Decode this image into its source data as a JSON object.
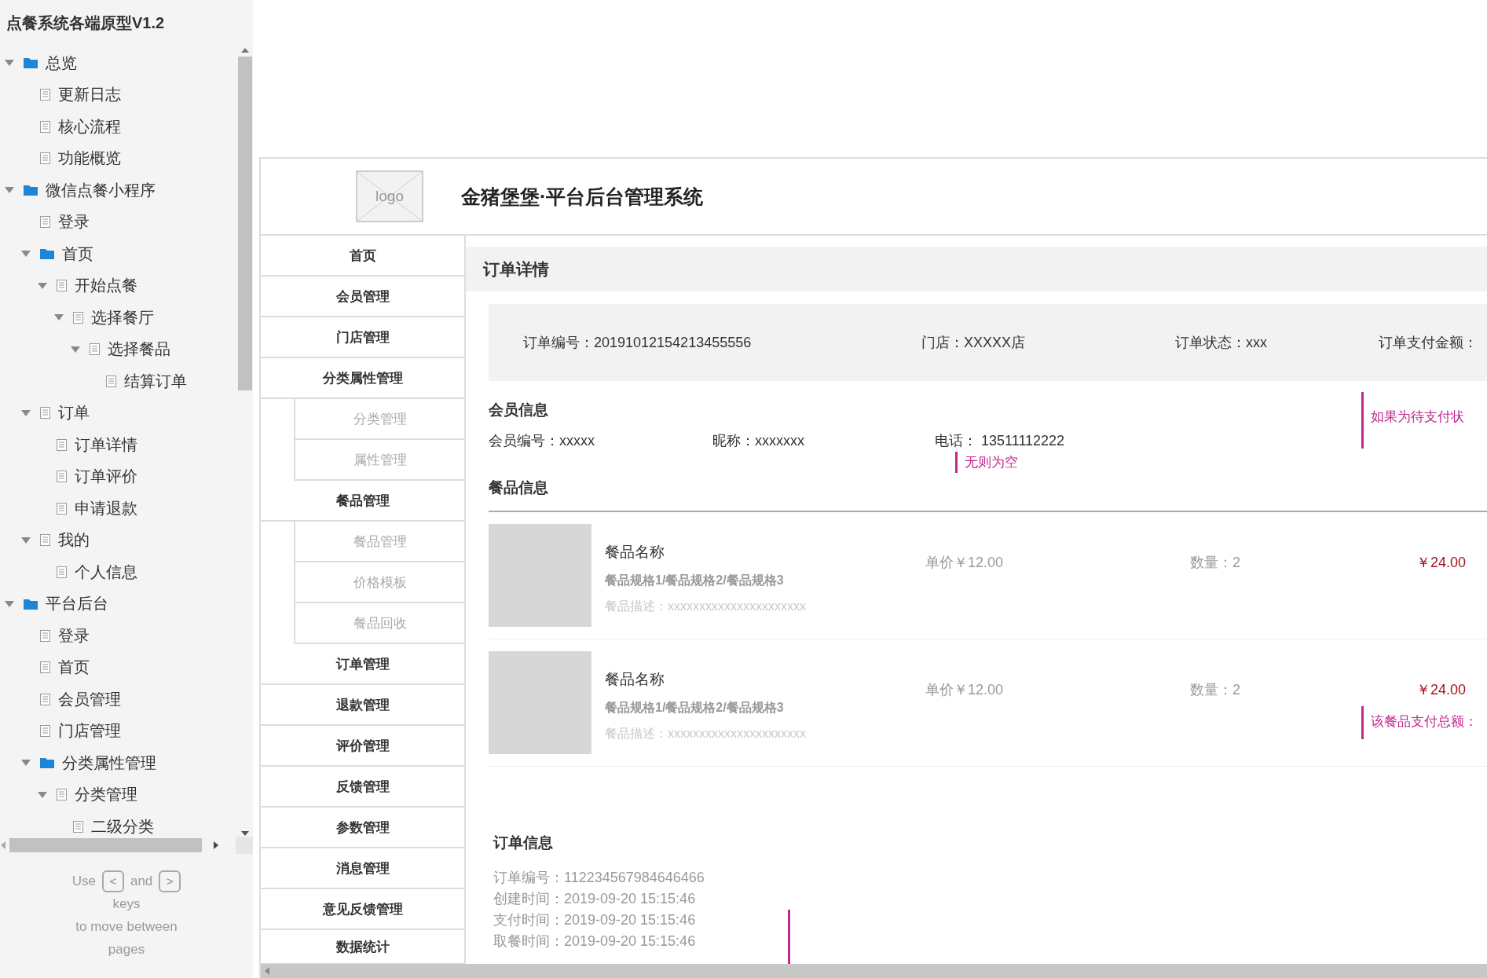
{
  "sidebar": {
    "title": "点餐系统各端原型V1.2",
    "tree": [
      {
        "label": "总览",
        "kind": "folder",
        "expanded": true,
        "children": [
          {
            "label": "更新日志",
            "kind": "page"
          },
          {
            "label": "核心流程",
            "kind": "page"
          },
          {
            "label": "功能概览",
            "kind": "page"
          }
        ]
      },
      {
        "label": "微信点餐小程序",
        "kind": "folder",
        "expanded": true,
        "children": [
          {
            "label": "登录",
            "kind": "page"
          },
          {
            "label": "首页",
            "kind": "folder",
            "expanded": true,
            "children": [
              {
                "label": "开始点餐",
                "kind": "page",
                "expanded": true,
                "children": [
                  {
                    "label": "选择餐厅",
                    "kind": "page",
                    "expanded": true,
                    "children": [
                      {
                        "label": "选择餐品",
                        "kind": "page",
                        "expanded": true,
                        "children": [
                          {
                            "label": "结算订单",
                            "kind": "page"
                          }
                        ]
                      }
                    ]
                  }
                ]
              }
            ]
          },
          {
            "label": "订单",
            "kind": "page",
            "expanded": true,
            "children": [
              {
                "label": "订单详情",
                "kind": "page"
              },
              {
                "label": "订单评价",
                "kind": "page"
              },
              {
                "label": "申请退款",
                "kind": "page"
              }
            ]
          },
          {
            "label": "我的",
            "kind": "page",
            "expanded": true,
            "children": [
              {
                "label": "个人信息",
                "kind": "page"
              }
            ]
          }
        ]
      },
      {
        "label": "平台后台",
        "kind": "folder",
        "expanded": true,
        "children": [
          {
            "label": "登录",
            "kind": "page"
          },
          {
            "label": "首页",
            "kind": "page"
          },
          {
            "label": "会员管理",
            "kind": "page"
          },
          {
            "label": "门店管理",
            "kind": "page"
          },
          {
            "label": "分类属性管理",
            "kind": "folder",
            "expanded": true,
            "children": [
              {
                "label": "分类管理",
                "kind": "page",
                "expanded": true,
                "children": [
                  {
                    "label": "二级分类",
                    "kind": "page"
                  }
                ]
              }
            ]
          }
        ]
      }
    ],
    "footer": {
      "use": "Use",
      "prev_key": "<",
      "and": "and",
      "next_key": ">",
      "keys": "keys",
      "line": "to move between",
      "pages": "pages"
    }
  },
  "header": {
    "logo": "logo",
    "title": "金猪堡堡·平台后台管理系统"
  },
  "nav": [
    {
      "label": "首页",
      "kind": "main"
    },
    {
      "label": "会员管理",
      "kind": "main"
    },
    {
      "label": "门店管理",
      "kind": "main"
    },
    {
      "label": "分类属性管理",
      "kind": "main"
    },
    {
      "label": "分类管理",
      "kind": "sub"
    },
    {
      "label": "属性管理",
      "kind": "sub"
    },
    {
      "label": "餐品管理",
      "kind": "main"
    },
    {
      "label": "餐品管理",
      "kind": "sub"
    },
    {
      "label": "价格模板",
      "kind": "sub"
    },
    {
      "label": "餐品回收",
      "kind": "sub"
    },
    {
      "label": "订单管理",
      "kind": "main"
    },
    {
      "label": "退款管理",
      "kind": "main"
    },
    {
      "label": "评价管理",
      "kind": "main"
    },
    {
      "label": "反馈管理",
      "kind": "main"
    },
    {
      "label": "参数管理",
      "kind": "main"
    },
    {
      "label": "消息管理",
      "kind": "main"
    },
    {
      "label": "意见反馈管理",
      "kind": "main"
    },
    {
      "label": "数据统计",
      "kind": "main"
    }
  ],
  "page_title": "订单详情",
  "summary": [
    "订单编号：20191012154213455556",
    "门店：XXXXX店",
    "订单状态：xxx",
    "订单支付金额："
  ],
  "member": {
    "heading": "会员信息",
    "fields": [
      "会员编号：xxxxx",
      "昵称：xxxxxxx",
      "电话： 13511112222"
    ],
    "note": "无则为空",
    "status_note": "如果为待支付状"
  },
  "dishes": {
    "heading": "餐品信息",
    "items": [
      {
        "name": "餐品名称",
        "spec": "餐品规格1/餐品规格2/餐品规格3",
        "desc": "餐品描述：xxxxxxxxxxxxxxxxxxxxxx",
        "price": "单价￥12.00",
        "qty": "数量：2",
        "total": "￥24.00"
      },
      {
        "name": "餐品名称",
        "spec": "餐品规格1/餐品规格2/餐品规格3",
        "desc": "餐品描述：xxxxxxxxxxxxxxxxxxxxxx",
        "price": "单价￥12.00",
        "qty": "数量：2",
        "total": "￥24.00",
        "note": "该餐品支付总额："
      }
    ]
  },
  "order_info": {
    "heading": "订单信息",
    "lines": [
      "订单编号：112234567984646466",
      "创建时间：2019-09-20 15:15:46",
      "支付时间：2019-09-20 15:15:46",
      "取餐时间：2019-09-20 15:15:46"
    ]
  }
}
